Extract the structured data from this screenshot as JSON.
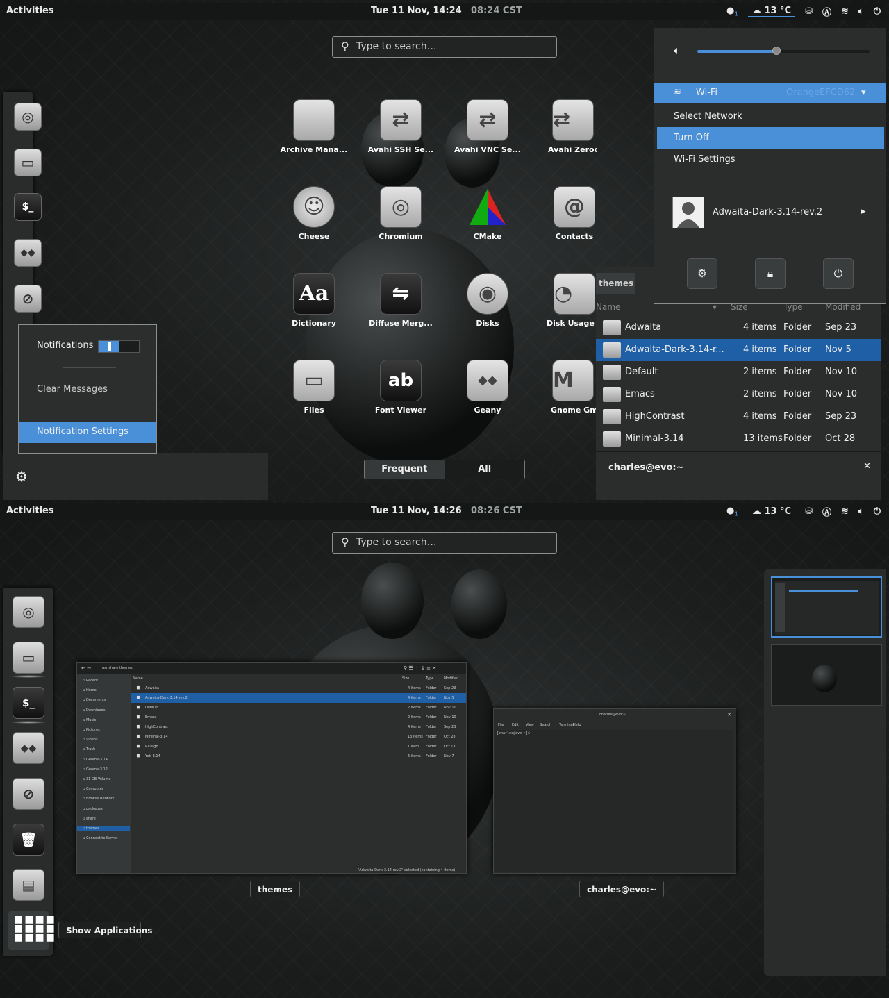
{
  "s1": {
    "topbar": {
      "activities": "Activities",
      "clock": "Tue 11 Nov, 14:24",
      "clock2": "08:24 CST",
      "notif_count": "1",
      "weather": "13 °C"
    },
    "search": {
      "placeholder": "Type to search…"
    },
    "apps": [
      {
        "label": "Archive Mana...",
        "icon": "archive-icon"
      },
      {
        "label": "Avahi SSH Se...",
        "icon": "arrows-icon"
      },
      {
        "label": "Avahi VNC Se...",
        "icon": "arrows-icon"
      },
      {
        "label": "Avahi Zeroco...",
        "icon": "arrows-icon"
      },
      {
        "label": "Cheese",
        "icon": "cheese-icon"
      },
      {
        "label": "Chromium",
        "icon": "chromium-icon"
      },
      {
        "label": "CMake",
        "icon": "cmake-icon"
      },
      {
        "label": "Contacts",
        "icon": "at-icon"
      },
      {
        "label": "Dictionary",
        "icon": "Aa"
      },
      {
        "label": "Diffuse Merg...",
        "icon": "diff-icon"
      },
      {
        "label": "Disks",
        "icon": "disk-icon"
      },
      {
        "label": "Disk Usage A...",
        "icon": "pie-icon"
      },
      {
        "label": "Files",
        "icon": "folder-icon"
      },
      {
        "label": "Font Viewer",
        "icon": "ab"
      },
      {
        "label": "Geany",
        "icon": "geany-icon"
      },
      {
        "label": "Gnome Gmail",
        "icon": "M"
      }
    ],
    "tabs": {
      "frequent": "Frequent",
      "all": "All"
    },
    "notif": {
      "notifications": "Notifications",
      "clear": "Clear Messages",
      "settings": "Notification Settings"
    },
    "status": {
      "wifi": "Wi-Fi",
      "network": "OrangeEFCD62",
      "select": "Select Network",
      "turnoff": "Turn Off",
      "wifi_settings": "Wi-Fi Settings",
      "user": "Adwaita-Dark-3.14-rev.2"
    },
    "fm": {
      "title": "themes",
      "cols": {
        "name": "Name",
        "size": "Size",
        "type": "Type",
        "modified": "Modified"
      },
      "rows": [
        {
          "name": "Adwaita",
          "size": "4 items",
          "type": "Folder",
          "mod": "Sep 23"
        },
        {
          "name": "Adwaita-Dark-3.14-r...",
          "size": "4 items",
          "type": "Folder",
          "mod": "Nov 5"
        },
        {
          "name": "Default",
          "size": "2 items",
          "type": "Folder",
          "mod": "Nov 10"
        },
        {
          "name": "Emacs",
          "size": "2 items",
          "type": "Folder",
          "mod": "Nov 10"
        },
        {
          "name": "HighContrast",
          "size": "4 items",
          "type": "Folder",
          "mod": "Sep 23"
        },
        {
          "name": "Minimal-3.14",
          "size": "13 items",
          "type": "Folder",
          "mod": "Oct 28"
        }
      ],
      "terminal_title": "charles@evo:~"
    },
    "volume": 0.46
  },
  "s2": {
    "topbar": {
      "activities": "Activities",
      "clock": "Tue 11 Nov, 14:26",
      "clock2": "08:26 CST",
      "notif_count": "1",
      "weather": "13 °C"
    },
    "search": {
      "placeholder": "Type to search…"
    },
    "windows": {
      "files_caption": "themes",
      "term_caption": "charles@evo:~"
    },
    "show_apps": "Show Applications",
    "mini_fm": {
      "path": [
        "usr",
        "share",
        "themes"
      ],
      "sidebar": [
        "Recent",
        "Home",
        "Documents",
        "Downloads",
        "Music",
        "Pictures",
        "Videos",
        "Trash",
        "Gnome-3.14",
        "Gnome-3.12",
        "31 GB Volume",
        "Computer",
        "Browse Network",
        "packages",
        "share",
        "themes",
        "Connect to Server"
      ],
      "cols": [
        "Name",
        "Size",
        "Type",
        "Modified"
      ],
      "rows": [
        [
          "Adwaita",
          "4 items",
          "Folder",
          "Sep 23"
        ],
        [
          "Adwaita-Dark-3.14-rev.2",
          "4 items",
          "Folder",
          "Nov 5"
        ],
        [
          "Default",
          "2 items",
          "Folder",
          "Nov 10"
        ],
        [
          "Emacs",
          "2 items",
          "Folder",
          "Nov 10"
        ],
        [
          "HighContrast",
          "4 items",
          "Folder",
          "Sep 23"
        ],
        [
          "Minimal-3.14",
          "13 items",
          "Folder",
          "Oct 28"
        ],
        [
          "Raleigh",
          "1 item",
          "Folder",
          "Oct 13"
        ],
        [
          "Yeti-3.14",
          "6 items",
          "Folder",
          "Nov 7"
        ]
      ],
      "statusbar": "\"Adwaita-Dark-3.14-rev.2\" selected (containing 4 items)"
    },
    "mini_term": {
      "title": "charles@evo:~",
      "menu": [
        "File",
        "Edit",
        "View",
        "Search",
        "Terminal",
        "Help"
      ],
      "prompt": "[charles@evo ~]$ "
    }
  },
  "colors": {
    "accent": "#4a90d9",
    "panel": "#151616",
    "selected_row": "#1f5fa6"
  }
}
